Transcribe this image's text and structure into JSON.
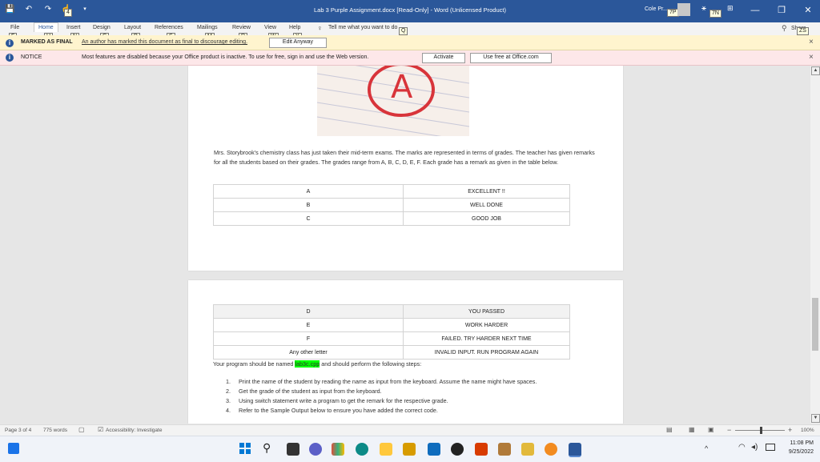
{
  "window": {
    "title": "Lab 3 Purple Assignment.docx [Read-Only] - Word (Unlicensed Product)",
    "user": "Cole Pr...",
    "keytips_top": [
      "4",
      "7P",
      "7N"
    ],
    "min": "—",
    "restore": "❐",
    "close": "✕"
  },
  "ribbon": {
    "tabs": [
      "File",
      "Home",
      "Insert",
      "Design",
      "Layout",
      "References",
      "Mailings",
      "Review",
      "View",
      "Help"
    ],
    "tell_me": "Tell me what you want to do",
    "share": "Share",
    "keytips": [
      "F",
      "H",
      "N",
      "G",
      "P",
      "S",
      "M",
      "R",
      "W",
      "Y",
      "Q",
      "ZS"
    ]
  },
  "final_bar": {
    "label": "MARKED AS FINAL",
    "message": "An author has marked this document as final to discourage editing.",
    "button": "Edit Anyway",
    "close": "×"
  },
  "notice_bar": {
    "label": "NOTICE",
    "message": "Most features are disabled because your Office product is inactive. To use for free, sign in and use the Web version.",
    "activate": "Activate",
    "use_free": "Use free at Office.com",
    "close": "×"
  },
  "document": {
    "paragraph": "Mrs. Storybrook's chemistry class has just taken their mid-term exams. The marks are represented in terms of grades. The teacher has given remarks for all the students based on their grades. The grades range from A, B, C, D, E, F. Each grade has a remark as given in the table below.",
    "table1": [
      {
        "grade": "A",
        "remark": "EXCELLENT !!"
      },
      {
        "grade": "B",
        "remark": "WELL DONE"
      },
      {
        "grade": "C",
        "remark": "GOOD JOB"
      }
    ],
    "table2": [
      {
        "grade": "D",
        "remark": "YOU PASSED"
      },
      {
        "grade": "E",
        "remark": "WORK HARDER"
      },
      {
        "grade": "F",
        "remark": "FAILED. TRY HARDER NEXT TIME"
      },
      {
        "grade": "Any other letter",
        "remark": "INVALID INPUT.  RUN PROGRAM AGAIN"
      }
    ],
    "program_pre": "Your program should be named ",
    "program_name": "lab3c.cpp",
    "program_post": " and should perform the following steps:",
    "steps": [
      "Print the name of the student by reading the name as input from the keyboard. Assume the name might have spaces.",
      "Get the grade of the student as input from the keyboard.",
      "Using switch statement write a program to get the remark for the respective grade.",
      "Refer to the Sample Output below to ensure you have added the correct code."
    ],
    "step_numbers": [
      "1.",
      "2.",
      "3.",
      "4."
    ],
    "image_letter": "A"
  },
  "status": {
    "page": "Page 3 of 4",
    "words": "775 words",
    "accessibility": "Accessibility: Investigate",
    "zoom": "100%",
    "zoom_minus": "−",
    "zoom_plus": "+"
  },
  "taskbar": {
    "time": "11:08 PM",
    "date": "9/25/2022",
    "tray_chevron": "^"
  },
  "colors": {
    "accent": "#2b579a",
    "highlight": "#00ff00",
    "final_bar": "#fff4ce",
    "notice_bar": "#fde7e9"
  }
}
